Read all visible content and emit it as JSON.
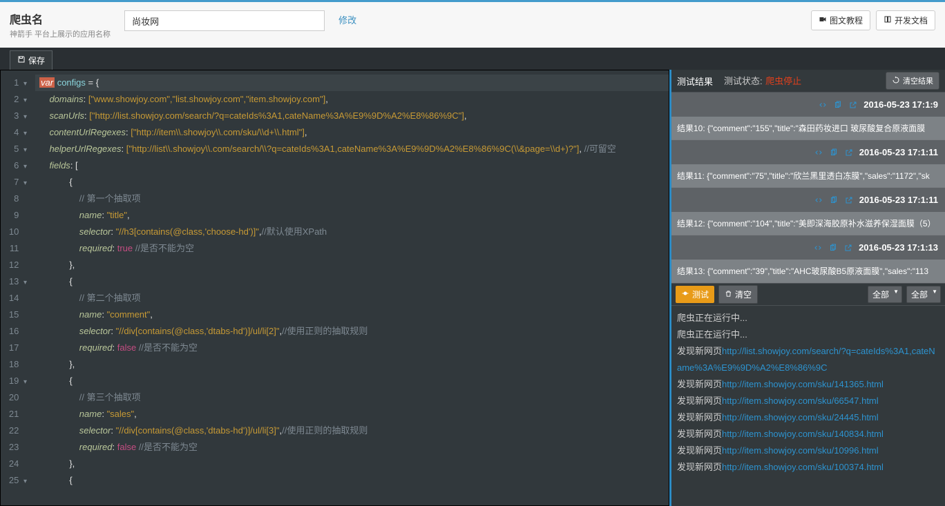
{
  "header": {
    "title": "爬虫名",
    "subtitle": "神箭手 平台上展示的应用名称",
    "name_value": "尚妆网",
    "modify": "修改",
    "tutorial_btn": "图文教程",
    "dev_doc_btn": "开发文档"
  },
  "toolbar": {
    "save": "保存"
  },
  "code": {
    "lines": [
      {
        "n": "1",
        "fold": "▾",
        "t": "var",
        "rest": " configs = {"
      },
      {
        "n": "2",
        "fold": "▾",
        "key": "domains",
        "val": "[\"www.showjoy.com\",\"list.showjoy.com\",\"item.showjoy.com\"]",
        "tail": ","
      },
      {
        "n": "3",
        "fold": "▾",
        "key": "scanUrls",
        "val": "[\"http://list.showjoy.com/search/?q=cateIds%3A1,cateName%3A%E9%9D%A2%E8%86%9C\"]",
        "tail": ","
      },
      {
        "n": "4",
        "fold": "▾",
        "key": "contentUrlRegexes",
        "val": "[\"http://item\\\\.showjoy\\\\.com/sku/\\\\d+\\\\.html\"]",
        "tail": ","
      },
      {
        "n": "5",
        "fold": "▾",
        "key": "helperUrlRegexes",
        "val": "[\"http://list\\\\.showjoy\\\\.com/search/\\\\?q=cateIds%3A1,cateName%3A%E9%9D%A2%E8%86%9C(\\\\&page=\\\\d+)?\"]",
        "tail": ",",
        "comm": " //可留空"
      },
      {
        "n": "6",
        "fold": "▾",
        "key": "fields",
        "plain": ": ["
      },
      {
        "n": "7",
        "fold": "▾",
        "plain": "            {"
      },
      {
        "n": "8",
        "comm": "                // 第一个抽取项"
      },
      {
        "n": "9",
        "key2": "name",
        "val2": "\"title\"",
        "tail": ","
      },
      {
        "n": "10",
        "key2": "selector",
        "val2": "\"//h3[contains(@class,'choose-hd')]\"",
        "tail": ",",
        "comm2": "//默认使用XPath"
      },
      {
        "n": "11",
        "key2": "required",
        "bool": "true",
        "comm2": " //是否不能为空"
      },
      {
        "n": "12",
        "plain": "            },"
      },
      {
        "n": "13",
        "fold": "▾",
        "plain": "            {"
      },
      {
        "n": "14",
        "comm": "                // 第二个抽取项"
      },
      {
        "n": "15",
        "key2": "name",
        "val2": "\"comment\"",
        "tail": ","
      },
      {
        "n": "16",
        "key2": "selector",
        "val2": "\"//div[contains(@class,'dtabs-hd')]/ul/li[2]\"",
        "tail": ",",
        "comm2": "//使用正则的抽取规则"
      },
      {
        "n": "17",
        "key2": "required",
        "bool": "false",
        "comm2": " //是否不能为空"
      },
      {
        "n": "18",
        "plain": "            },"
      },
      {
        "n": "19",
        "fold": "▾",
        "plain": "            {"
      },
      {
        "n": "20",
        "comm": "                // 第三个抽取项"
      },
      {
        "n": "21",
        "key2": "name",
        "val2": "\"sales\"",
        "tail": ","
      },
      {
        "n": "22",
        "key2": "selector",
        "val2": "\"//div[contains(@class,'dtabs-hd')]/ul/li[3]\"",
        "tail": ",",
        "comm2": "//使用正则的抽取规则"
      },
      {
        "n": "23",
        "key2": "required",
        "bool": "false",
        "comm2": " //是否不能为空"
      },
      {
        "n": "24",
        "plain": "            },"
      },
      {
        "n": "25",
        "fold": "▾",
        "plain": "            {"
      }
    ]
  },
  "results_panel": {
    "title": "测试结果",
    "status_label": "测试状态:",
    "status_value": "爬虫停止",
    "clear_btn": "清空结果",
    "items": [
      {
        "ts": "2016-05-23 17:1:9",
        "txt": "结果10: {\"comment\":\"155\",\"title\":\"森田药妆进口 玻尿酸复合原液面膜 "
      },
      {
        "ts": "2016-05-23 17:1:11",
        "txt": "结果11: {\"comment\":\"75\",\"title\":\"欣兰黑里透白冻膜\",\"sales\":\"1172\",\"sk"
      },
      {
        "ts": "2016-05-23 17:1:11",
        "txt": "结果12: {\"comment\":\"104\",\"title\":\"美即深海胶原补水滋养保湿面膜（5）"
      },
      {
        "ts": "2016-05-23 17:1:13",
        "txt": "结果13: {\"comment\":\"39\",\"title\":\"AHC玻尿酸B5原液面膜\",\"sales\":\"113"
      }
    ]
  },
  "log_panel": {
    "test_btn": "测试",
    "clear_btn": "清空",
    "select1": "全部",
    "select2": "全部",
    "lines": [
      {
        "text": "爬虫正在运行中...",
        "link": ""
      },
      {
        "text": "爬虫正在运行中...",
        "link": ""
      },
      {
        "text": "发现新网页",
        "link": "http://list.showjoy.com/search/?q=cateIds%3A1,cateName%3A%E9%9D%A2%E8%86%9C",
        "wrap": true
      },
      {
        "text": "发现新网页",
        "link": "http://item.showjoy.com/sku/141365.html"
      },
      {
        "text": "发现新网页",
        "link": "http://item.showjoy.com/sku/66547.html"
      },
      {
        "text": "发现新网页",
        "link": "http://item.showjoy.com/sku/24445.html"
      },
      {
        "text": "发现新网页",
        "link": "http://item.showjoy.com/sku/140834.html"
      },
      {
        "text": "发现新网页",
        "link": "http://item.showjoy.com/sku/10996.html"
      },
      {
        "text": "发现新网页",
        "link": "http://item.showjoy.com/sku/100374.html"
      }
    ]
  }
}
